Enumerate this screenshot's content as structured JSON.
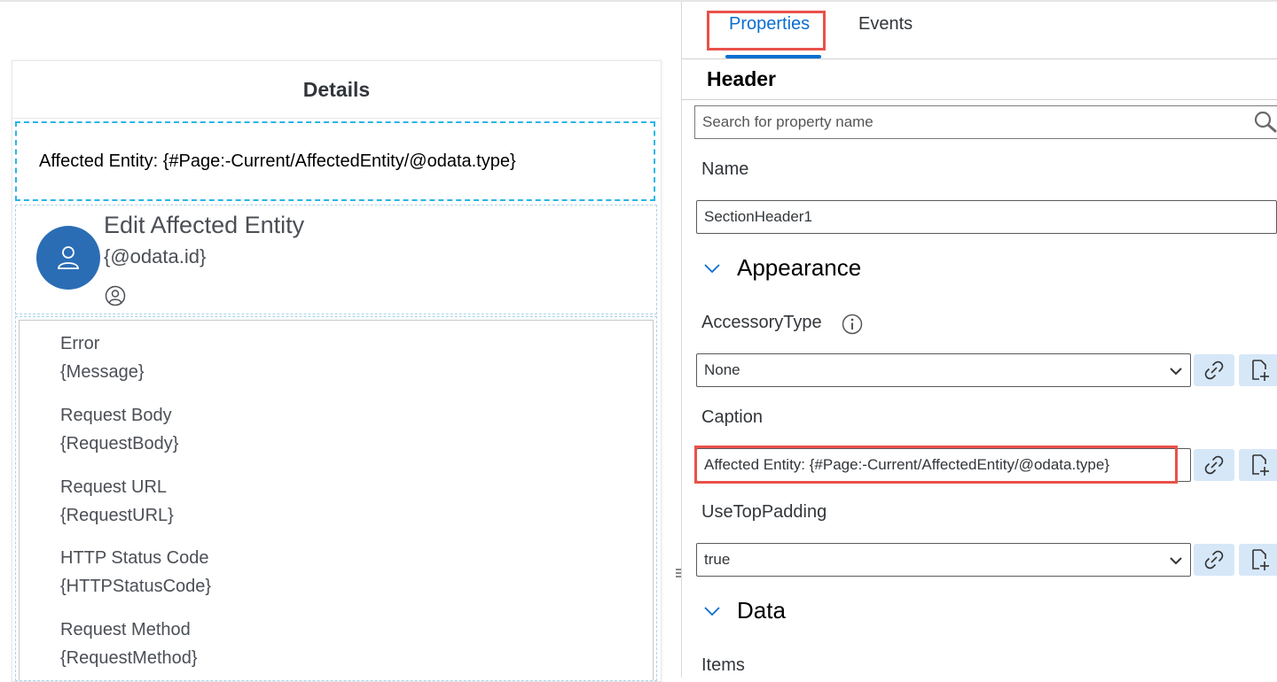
{
  "canvas": {
    "page_title": "Details",
    "section_header_caption": "Affected Entity: {#Page:-Current/AffectedEntity/@odata.type}",
    "object_cell": {
      "title": "Edit Affected Entity",
      "subtitle": "{@odata.id}",
      "avatar_icon": "person-icon",
      "status_icon": "person-circle-icon"
    },
    "key_values": [
      {
        "label": "Error",
        "value": "{Message}"
      },
      {
        "label": "Request Body",
        "value": "{RequestBody}"
      },
      {
        "label": "Request URL",
        "value": "{RequestURL}"
      },
      {
        "label": "HTTP Status Code",
        "value": "{HTTPStatusCode}"
      },
      {
        "label": "Request Method",
        "value": "{RequestMethod}"
      }
    ]
  },
  "properties_pane": {
    "tabs": [
      {
        "label": "Properties",
        "active": true
      },
      {
        "label": "Events",
        "active": false
      }
    ],
    "title": "Header",
    "search_placeholder": "Search for property name",
    "name_label": "Name",
    "name_value": "SectionHeader1",
    "appearance_label": "Appearance",
    "accessory_type_label": "AccessoryType",
    "accessory_type_value": "None",
    "caption_label": "Caption",
    "caption_value": "Affected Entity: {#Page:-Current/AffectedEntity/@odata.type}",
    "use_top_padding_label": "UseTopPadding",
    "use_top_padding_value": "true",
    "data_label": "Data",
    "items_label": "Items"
  },
  "colors": {
    "accent": "#0a6ed1",
    "highlight": "#e9514a",
    "avatar": "#2a6db5",
    "selection_dash": "#29b6e6"
  }
}
